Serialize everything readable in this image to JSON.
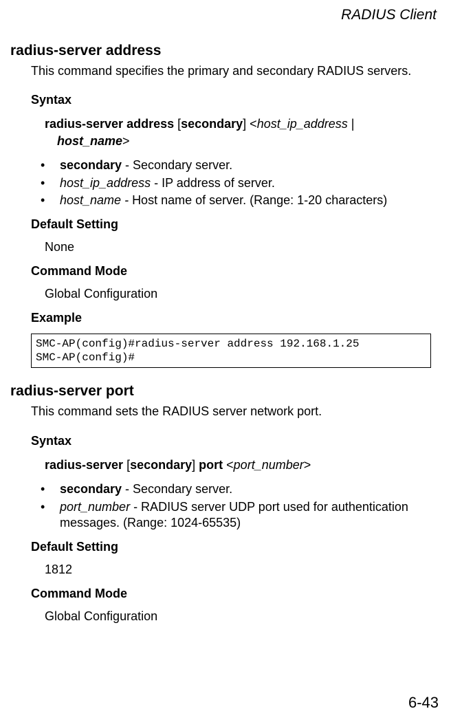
{
  "header": {
    "section": "RADIUS Client"
  },
  "footer": {
    "page": "6-43"
  },
  "cmd1": {
    "title": "radius-server address",
    "desc": "This command specifies the primary and secondary RADIUS servers.",
    "syntax_heading": "Syntax",
    "syntax": {
      "kw1": "radius-server address",
      "br1": " [",
      "kw2": "secondary",
      "br2": "] <",
      "arg1": "host_ip_address",
      "sep": " | ",
      "arg2": "host_name",
      "br3": ">"
    },
    "bullets": [
      {
        "term_b": "secondary",
        "rest": " - Secondary server."
      },
      {
        "term_i": "host_ip_address",
        "rest": " - IP address of server."
      },
      {
        "term_i": "host_name",
        "rest_beforedash": " - ",
        "rest": "Host name of server. (Range: 1-20 characters)"
      }
    ],
    "default_heading": "Default Setting",
    "default_value": "None",
    "mode_heading": "Command Mode",
    "mode_value": "Global Configuration",
    "example_heading": "Example",
    "example_code": "SMC-AP(config)#radius-server address 192.168.1.25\nSMC-AP(config)#"
  },
  "cmd2": {
    "title": "radius-server port",
    "desc": "This command sets the RADIUS server network port.",
    "syntax_heading": "Syntax",
    "syntax": {
      "kw1": "radius-server",
      "br1": " [",
      "kw2": "secondary",
      "br2": "] ",
      "kw3": "port",
      "br3": " <",
      "arg1": "port_number",
      "br4": ">"
    },
    "bullets": [
      {
        "term_b": "secondary",
        "rest": " - Secondary server."
      },
      {
        "term_i": "port_number",
        "rest": " - RADIUS server UDP port used for authentication messages. (Range: 1024-65535)"
      }
    ],
    "default_heading": "Default Setting",
    "default_value": "1812",
    "mode_heading": "Command Mode",
    "mode_value": "Global Configuration"
  }
}
